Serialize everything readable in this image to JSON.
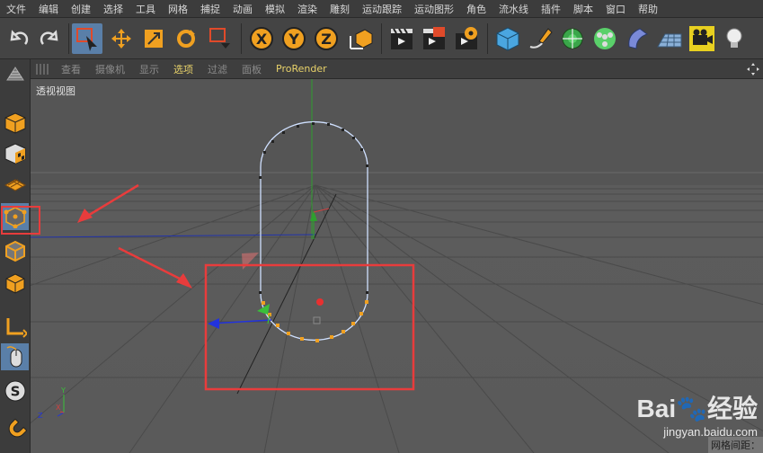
{
  "menubar": {
    "items": [
      "文件",
      "编辑",
      "创建",
      "选择",
      "工具",
      "网格",
      "捕捉",
      "动画",
      "模拟",
      "渲染",
      "雕刻",
      "运动跟踪",
      "运动图形",
      "角色",
      "流水线",
      "插件",
      "脚本",
      "窗口",
      "帮助"
    ]
  },
  "toolbar": {
    "axis_x": "X",
    "axis_y": "Y",
    "axis_z": "Z"
  },
  "viewport_menu": {
    "items": [
      "查看",
      "摄像机",
      "显示",
      "选项",
      "过滤",
      "面板"
    ],
    "highlighted": "选项",
    "renderer": "ProRender"
  },
  "viewport": {
    "label": "透视视图",
    "grid_spacing_label": "网格间距："
  },
  "watermark": {
    "brand": "Bai",
    "brand_suffix": "经验",
    "url": "jingyan.baidu.com"
  },
  "colors": {
    "accent": "#5a7fa8",
    "annotation": "#e83c3c",
    "highlight_text": "#e8d26a",
    "point_selected": "#f0a020"
  }
}
